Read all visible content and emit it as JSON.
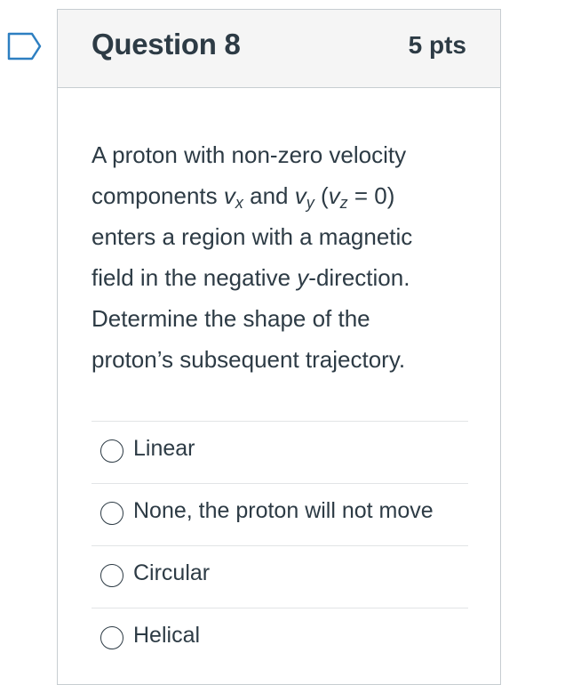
{
  "question": {
    "title": "Question 8",
    "points": "5 pts",
    "text": {
      "line1": "A proton with non-zero velocity",
      "line2_a": "components ",
      "vx": "v",
      "vx_sub": "x",
      "line2_b": "and ",
      "vy": "v",
      "vy_sub": "y",
      "line2_c": " (",
      "vz": "v",
      "vz_sub": "z",
      "line2_d": " = 0)",
      "line3": "enters a region with a magnetic",
      "line4_a": "field in the negative ",
      "line4_var": "y",
      "line4_b": "-direction.",
      "line5": "Determine the shape of the",
      "line6": "proton’s subsequent trajectory."
    }
  },
  "answers": [
    {
      "label": "Linear",
      "selected": false
    },
    {
      "label": "None, the proton will not move",
      "selected": false
    },
    {
      "label": "Circular",
      "selected": false
    },
    {
      "label": "Helical",
      "selected": false
    }
  ],
  "icons": {
    "bookmark": "bookmark-flag-icon"
  },
  "colors": {
    "text": "#2d3b45",
    "header_bg": "#f5f5f5",
    "border": "#c7cdd1",
    "bookmark": "#2d7fc1"
  }
}
